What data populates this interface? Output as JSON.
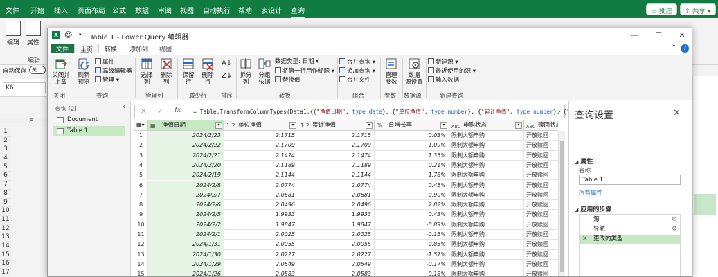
{
  "excel": {
    "tabs": [
      "文件",
      "开始",
      "插入",
      "页面布局",
      "公式",
      "数据",
      "审阅",
      "视图",
      "自动执行",
      "帮助",
      "表设计",
      "查询"
    ],
    "active_tab": "查询",
    "comment_btn": "批注",
    "share_btn": "共享",
    "edit_label": "编辑",
    "props_label": "属性",
    "edit_group": "编辑",
    "autosave_label": "自动保存",
    "autosave_state": "关",
    "name_box": "K6",
    "col_e": "E",
    "row_numbers": [
      "1",
      "2",
      "3",
      "4",
      "5",
      "6",
      "7",
      "8",
      "9",
      "10",
      "11",
      "12",
      "13",
      "14",
      "15",
      "16",
      "17"
    ]
  },
  "pq": {
    "title": "Table 1 - Power Query 编辑器",
    "tabs": {
      "file": "文件",
      "home": "主页",
      "transform": "转换",
      "add_col": "添加列",
      "view": "视图"
    },
    "ribbon": {
      "close_load": "关闭并\n上载",
      "refresh": "刷新\n预览",
      "properties": "属性",
      "advanced_editor": "高级编辑器",
      "manage": "管理",
      "choose_cols": "选择\n列",
      "remove_cols": "删除\n列",
      "keep_rows": "保留\n行",
      "remove_rows": "删除\n行",
      "split_col": "拆分\n列",
      "group_by": "分组\n依据",
      "data_type": "数据类型: 日期",
      "first_row_header": "将第一行用作标题",
      "replace_values": "替换值",
      "merge_queries": "合并查询",
      "append_queries": "追加查询",
      "combine_files": "合并文件",
      "manage_params": "管理\n参数",
      "data_source_settings": "数据\n源设置",
      "new_source": "新建源",
      "recent_sources": "最近使用的源",
      "enter_data": "输入数据",
      "groups": {
        "close": "关闭",
        "query": "查询",
        "manage_cols": "管理列",
        "reduce_rows": "减少行",
        "sort": "排序",
        "transform": "转换",
        "combine": "组合",
        "params": "参数",
        "data_source": "数据源",
        "new_query": "新建查询"
      }
    },
    "queries": {
      "header": "查询 [2]",
      "items": [
        "Document",
        "Table 1"
      ]
    },
    "formula": {
      "p1": "= Table.TransformColumnTypes(Data1,{{",
      "s1": "\"净值日期\"",
      "p2": ", ",
      "k1": "type date",
      "p3": "}, {",
      "s2": "\"单位净值\"",
      "p4": ", ",
      "k2": "type number",
      "p5": "}, {",
      "s3": "\"累计净值\"",
      "p6": ", ",
      "k3": "type number",
      "p7": "}, {",
      "s4": "\""
    },
    "columns": [
      {
        "type_icon": "▦",
        "name": "净值日期"
      },
      {
        "type_icon": "1.2",
        "name": "单位净值"
      },
      {
        "type_icon": "1.2",
        "name": "累计净值"
      },
      {
        "type_icon": "%",
        "name": "日增长率"
      },
      {
        "type_icon": "ABC",
        "name": "申购状态"
      },
      {
        "type_icon": "ABC",
        "name": "赎回状态"
      }
    ],
    "rows": [
      {
        "n": "1",
        "date": "2024/2/23",
        "nav": "2.1715",
        "acc": "2.1715",
        "pct": "0.03%",
        "buy": "限制大额申购",
        "sell": "开放赎回"
      },
      {
        "n": "2",
        "date": "2024/2/22",
        "nav": "2.1709",
        "acc": "2.1709",
        "pct": "1.09%",
        "buy": "限制大额申购",
        "sell": "开放赎回"
      },
      {
        "n": "3",
        "date": "2024/2/21",
        "nav": "2.1474",
        "acc": "2.1474",
        "pct": "1.35%",
        "buy": "限制大额申购",
        "sell": "开放赎回"
      },
      {
        "n": "4",
        "date": "2024/2/20",
        "nav": "2.1189",
        "acc": "2.1189",
        "pct": "0.21%",
        "buy": "限制大额申购",
        "sell": "开放赎回"
      },
      {
        "n": "5",
        "date": "2024/2/19",
        "nav": "2.1144",
        "acc": "2.1144",
        "pct": "1.78%",
        "buy": "限制大额申购",
        "sell": "开放赎回"
      },
      {
        "n": "6",
        "date": "2024/2/8",
        "nav": "2.0774",
        "acc": "2.0774",
        "pct": "0.45%",
        "buy": "限制大额申购",
        "sell": "开放赎回"
      },
      {
        "n": "7",
        "date": "2024/2/7",
        "nav": "2.0681",
        "acc": "2.0681",
        "pct": "0.90%",
        "buy": "限制大额申购",
        "sell": "开放赎回"
      },
      {
        "n": "8",
        "date": "2024/2/6",
        "nav": "2.0496",
        "acc": "2.0496",
        "pct": "2.82%",
        "buy": "限制大额申购",
        "sell": "开放赎回"
      },
      {
        "n": "9",
        "date": "2024/2/5",
        "nav": "1.9933",
        "acc": "1.9933",
        "pct": "0.43%",
        "buy": "限制大额申购",
        "sell": "开放赎回"
      },
      {
        "n": "10",
        "date": "2024/2/2",
        "nav": "1.9847",
        "acc": "1.9847",
        "pct": "-0.89%",
        "buy": "限制大额申购",
        "sell": "开放赎回"
      },
      {
        "n": "11",
        "date": "2024/2/1",
        "nav": "2.0025",
        "acc": "2.0025",
        "pct": "-0.15%",
        "buy": "限制大额申购",
        "sell": "开放赎回"
      },
      {
        "n": "12",
        "date": "2024/1/31",
        "nav": "2.0055",
        "acc": "2.0055",
        "pct": "-0.85%",
        "buy": "限制大额申购",
        "sell": "开放赎回"
      },
      {
        "n": "13",
        "date": "2024/1/30",
        "nav": "2.0227",
        "acc": "2.0227",
        "pct": "-1.57%",
        "buy": "限制大额申购",
        "sell": "开放赎回"
      },
      {
        "n": "14",
        "date": "2024/1/29",
        "nav": "2.0549",
        "acc": "2.0549",
        "pct": "-0.17%",
        "buy": "限制大额申购",
        "sell": "开放赎回"
      },
      {
        "n": "15",
        "date": "2024/1/26",
        "nav": "2.0583",
        "acc": "2.0583",
        "pct": "0.18%",
        "buy": "限制大额申购",
        "sell": "开放赎回"
      }
    ],
    "settings": {
      "title": "查询设置",
      "props_section": "属性",
      "name_label": "名称",
      "name_value": "Table 1",
      "all_props": "所有属性",
      "steps_section": "应用的步骤",
      "steps": [
        "源",
        "导航",
        "更改的类型"
      ]
    }
  }
}
